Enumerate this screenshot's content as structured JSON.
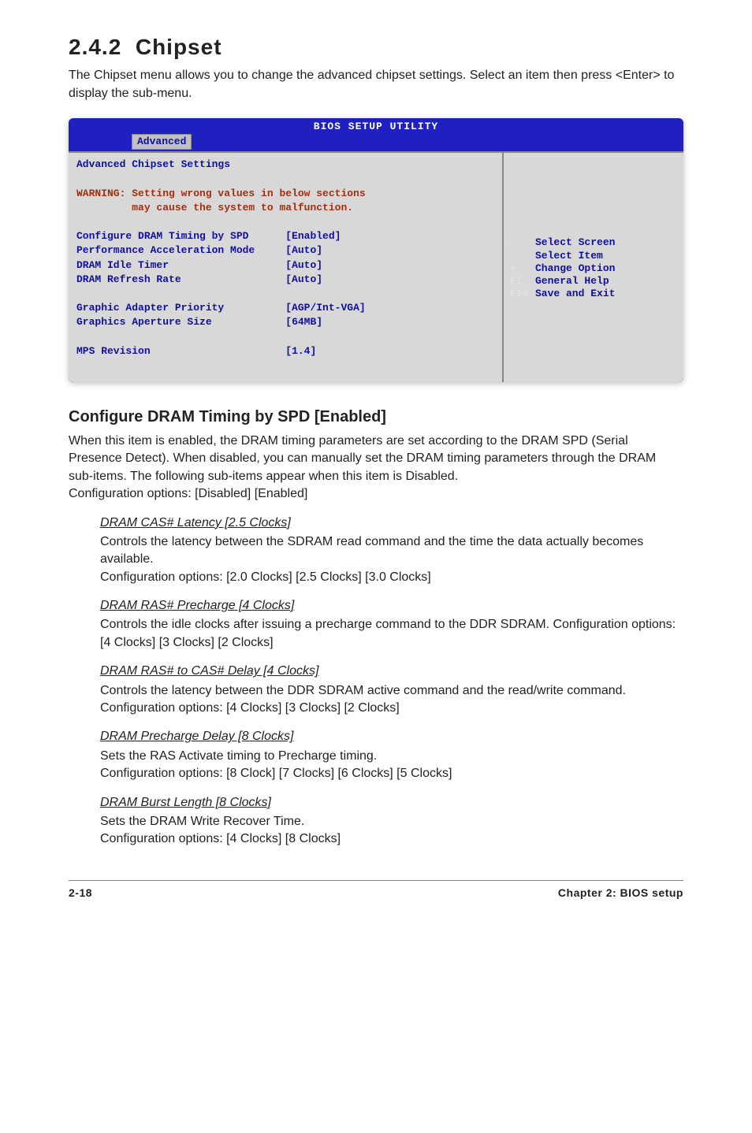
{
  "section_number": "2.4.2",
  "section_title": "Chipset",
  "intro": "The Chipset menu allows you to change the advanced chipset settings. Select an item then press <Enter> to display the sub-menu.",
  "bios": {
    "utility_title": "BIOS SETUP UTILITY",
    "tab": "Advanced",
    "panel_heading": "Advanced Chipset Settings",
    "warning_line1": "WARNING: Setting wrong values in below sections",
    "warning_line2": "         may cause the system to malfunction.",
    "rows": [
      {
        "label": "Configure DRAM Timing by SPD",
        "value": "[Enabled]"
      },
      {
        "label": "Performance Acceleration Mode",
        "value": "[Auto]"
      },
      {
        "label": "DRAM Idle Timer",
        "value": "[Auto]"
      },
      {
        "label": "DRAM Refresh Rate",
        "value": "[Auto]"
      }
    ],
    "rows2": [
      {
        "label": "Graphic Adapter Priority",
        "value": "[AGP/Int-VGA]"
      },
      {
        "label": "Graphics Aperture Size",
        "value": "[64MB]"
      }
    ],
    "rows3": [
      {
        "label": "MPS Revision",
        "value": "[1.4]"
      }
    ],
    "help_keys": [
      {
        "key": "←→",
        "label": "Select Screen"
      },
      {
        "key": "↑↓",
        "label": "Select Item"
      },
      {
        "key": "+-",
        "label": "Change Option"
      },
      {
        "key": "F1",
        "label": "General Help"
      },
      {
        "key": "F10",
        "label": "Save and Exit"
      }
    ]
  },
  "subhead1": "Configure DRAM Timing by SPD [Enabled]",
  "subhead1_para": "When this item is enabled, the DRAM timing parameters are set according to the DRAM SPD (Serial Presence Detect). When disabled, you can manually set the DRAM timing parameters through the DRAM sub-items. The following sub-items appear when this item is Disabled.",
  "subhead1_opts": "Configuration options: [Disabled] [Enabled]",
  "items": [
    {
      "title": "DRAM CAS# Latency [2.5 Clocks]",
      "body": "Controls the latency between the SDRAM read command and the time the data actually becomes available.",
      "opts": "Configuration options: [2.0 Clocks] [2.5 Clocks] [3.0 Clocks]"
    },
    {
      "title": "DRAM RAS# Precharge [4 Clocks]",
      "body": "Controls the idle clocks after issuing a precharge command to the DDR SDRAM. Configuration options: [4 Clocks] [3 Clocks] [2 Clocks]",
      "opts": ""
    },
    {
      "title": "DRAM RAS# to CAS# Delay [4 Clocks]",
      "body": "Controls the latency between the DDR SDRAM active command and the read/write command. Configuration options: [4 Clocks] [3 Clocks] [2 Clocks]",
      "opts": ""
    },
    {
      "title": "DRAM Precharge Delay [8 Clocks]",
      "body": "Sets the RAS Activate timing to Precharge timing.",
      "opts": "Configuration options: [8 Clock] [7 Clocks] [6 Clocks] [5 Clocks]"
    },
    {
      "title": "DRAM Burst Length [8 Clocks]",
      "body": "Sets the DRAM Write Recover Time.",
      "opts": "Configuration options: [4 Clocks] [8 Clocks]"
    }
  ],
  "footer_left": "2-18",
  "footer_right": "Chapter 2: BIOS setup"
}
